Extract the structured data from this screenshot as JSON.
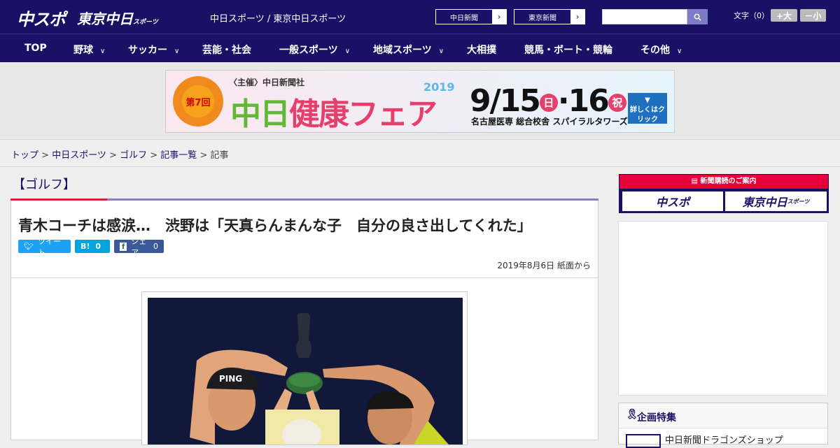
{
  "header": {
    "logo_main": "中スポ",
    "logo_sub": "東京中日",
    "logo_sub_small": "スポーツ",
    "site_names": "中日スポーツ / 東京中日スポーツ",
    "pill_1": "中日新聞",
    "pill_2": "東京新聞",
    "font_label": "文字（0）",
    "font_larger": "+大",
    "font_smaller": "－小"
  },
  "nav": {
    "items": [
      {
        "label": "TOP",
        "dropdown": false
      },
      {
        "label": "野球",
        "dropdown": true
      },
      {
        "label": "サッカー",
        "dropdown": true
      },
      {
        "label": "芸能・社会",
        "dropdown": false
      },
      {
        "label": "一般スポーツ",
        "dropdown": true
      },
      {
        "label": "地域スポーツ",
        "dropdown": true
      },
      {
        "label": "大相撲",
        "dropdown": false
      },
      {
        "label": "競馬・ボート・競輪",
        "dropdown": false
      },
      {
        "label": "その他",
        "dropdown": true
      }
    ]
  },
  "banner": {
    "badge": "第7回",
    "organizer": "〈主催〉中日新聞社",
    "year": "2019",
    "title_a": "中日",
    "title_b": "健康フェア",
    "date_a": "9/15",
    "day_a": "日",
    "date_b": "·16",
    "day_b": "祝",
    "venue": "名古屋医専 総合校舎 スパイラルタワーズ",
    "button": "詳しくはクリック"
  },
  "breadcrumb": {
    "items": [
      "トップ",
      "中日スポーツ",
      "ゴルフ",
      "記事一覧"
    ],
    "current": "記事",
    "sep": " > "
  },
  "article": {
    "category": "【ゴルフ】",
    "headline": "青木コーチは感涙…　渋野は「天真らんまんな子　自分の良さ出してくれた」",
    "share_tweet": "ツイート",
    "share_hatena": "B!",
    "share_hatena_count": "0",
    "share_fb": "シェア",
    "share_fb_count": "0",
    "date": "2019年8月6日 紙面から"
  },
  "sidebar": {
    "ad_header": "新聞購読のご案内",
    "ad_left": "中スポ",
    "ad_right": "東京中日",
    "ad_right_small": "スポーツ",
    "feature_title": "企画特集",
    "feature_item": "中日新聞ドラゴンズショップ"
  },
  "colors": {
    "brand_navy": "#1a1066",
    "accent_red": "#d1213a",
    "twitter": "#1da1f2",
    "hatena": "#00a4de",
    "facebook": "#3b5998"
  }
}
